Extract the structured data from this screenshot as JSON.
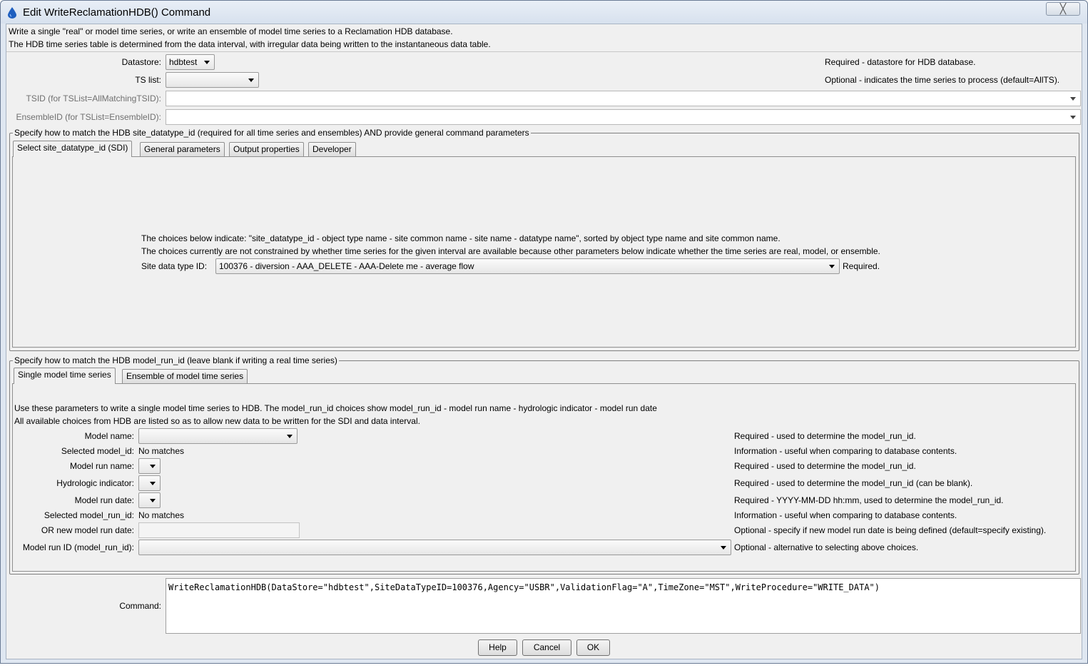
{
  "window": {
    "title": "Edit WriteReclamationHDB() Command",
    "close_glyph": "╳"
  },
  "intro": {
    "line1": "Write a single \"real\" or model time series, or write an ensemble of model time series to a Reclamation HDB database.",
    "line2": "The HDB time series table is determined from the data interval, with irregular data being written to the instantaneous data table."
  },
  "top_params": {
    "datastore": {
      "label": "Datastore:",
      "value": "hdbtest",
      "note": "Required - datastore for HDB database."
    },
    "tslist": {
      "label": "TS list:",
      "value": "",
      "note": "Optional - indicates the time series to process (default=AllTS)."
    },
    "tsid": {
      "label": "TSID (for TSList=AllMatchingTSID):",
      "value": ""
    },
    "ensembleid": {
      "label": "EnsembleID (for TSList=EnsembleID):",
      "value": ""
    }
  },
  "sdi_group": {
    "legend": "Specify how to match the HDB site_datatype_id (required for all time series and ensembles) AND provide general command parameters",
    "tabs": [
      "Select site_datatype_id (SDI)",
      "General parameters",
      "Output properties",
      "Developer"
    ],
    "info1": "The choices below indicate: \"site_datatype_id - object type name - site common name - site name - datatype name\", sorted by object type name and site common name.",
    "info2": "The choices currently are not constrained by whether time series for the given interval are available because other parameters below indicate whether the time series are real, model, or ensemble.",
    "sdi_label": "Site data type ID:",
    "sdi_value": "100376 - diversion - AAA_DELETE - AAA-Delete me - average flow",
    "sdi_note": "Required."
  },
  "model_group": {
    "legend": "Specify how to match the HDB model_run_id (leave blank if writing a real time series)",
    "tabs": [
      "Single model time series",
      "Ensemble of model time series"
    ],
    "info1": "Use these parameters to write a single model time series to HDB.  The model_run_id choices show model_run_id - model run name - hydrologic indicator - model run date",
    "info2": "All available choices from HDB are listed so as to allow new data to be written for the SDI and data interval.",
    "rows": {
      "model_name": {
        "label": "Model name:",
        "value": "",
        "note": "Required - used to determine the model_run_id."
      },
      "selected_model_id": {
        "label": "Selected model_id:",
        "value": "No matches",
        "note": "Information - useful when comparing to database contents."
      },
      "model_run_name": {
        "label": "Model run name:",
        "value": "",
        "note": "Required - used to determine the model_run_id."
      },
      "hydrologic_indicator": {
        "label": "Hydrologic indicator:",
        "value": "",
        "note": "Required - used to determine the model_run_id (can be blank)."
      },
      "model_run_date": {
        "label": "Model run date:",
        "value": "",
        "note": "Required - YYYY-MM-DD hh:mm, used to determine the model_run_id."
      },
      "selected_model_run_id": {
        "label": "Selected model_run_id:",
        "value": "No matches",
        "note": "Information - useful when comparing to database contents."
      },
      "new_model_run_date": {
        "label": "OR new  model run date:",
        "value": "",
        "note": "Optional - specify if new model run date is being defined (default=specify existing)."
      },
      "model_run_id": {
        "label": "Model run ID (model_run_id):",
        "value": "",
        "note": "Optional - alternative to selecting above choices."
      }
    }
  },
  "command": {
    "label": "Command:",
    "text": "WriteReclamationHDB(DataStore=\"hdbtest\",SiteDataTypeID=100376,Agency=\"USBR\",ValidationFlag=\"A\",TimeZone=\"MST\",WriteProcedure=\"WRITE_DATA\")"
  },
  "buttons": {
    "help": "Help",
    "cancel": "Cancel",
    "ok": "OK"
  },
  "colors": {
    "window_frame": "#dfe7f1",
    "panel": "#f0f0f0",
    "title_icon": "#1f5fbf"
  }
}
